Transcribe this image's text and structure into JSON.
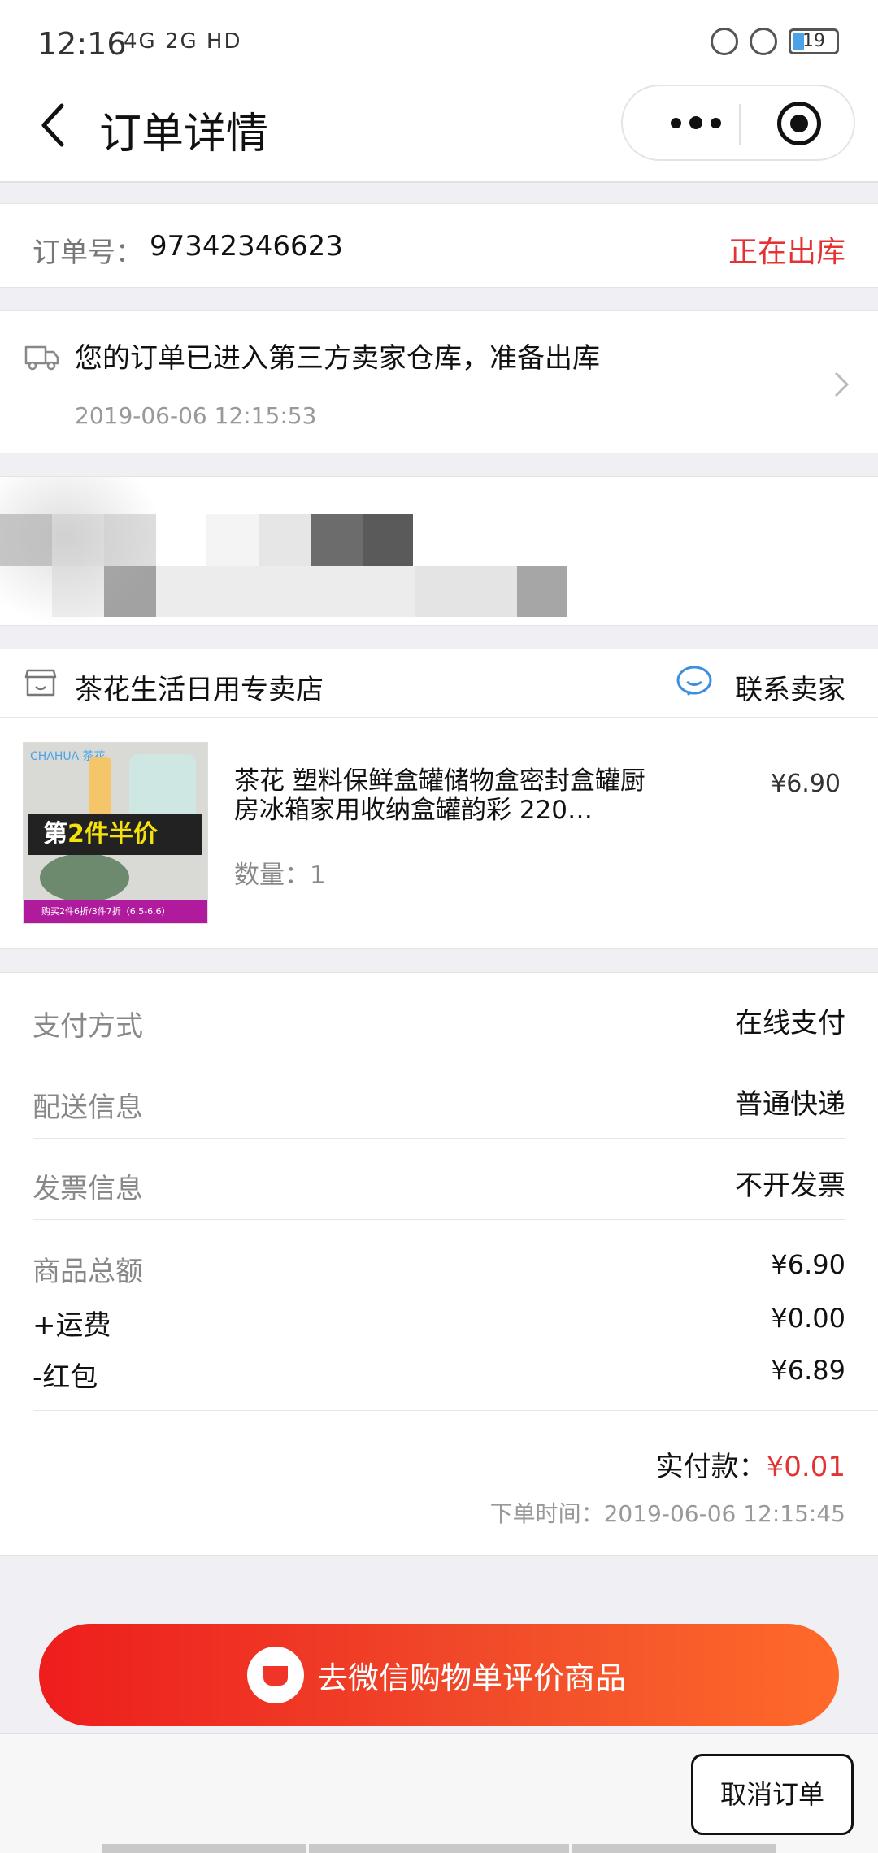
{
  "status_bar": {
    "time": "12:16",
    "signals": "4G 2G HD",
    "battery": "19"
  },
  "nav": {
    "title": "订单详情"
  },
  "order": {
    "number_label": "订单号：",
    "number": "97342346623",
    "status": "正在出库"
  },
  "logistics": {
    "message": "您的订单已进入第三方卖家仓库，准备出库",
    "time": "2019-06-06 12:15:53"
  },
  "shop": {
    "name": "茶花生活日用专卖店",
    "contact_label": "联系卖家"
  },
  "product": {
    "name": "茶花 塑料保鲜盒罐储物盒密封盒罐厨房冰箱家用收纳盒罐韵彩 220…",
    "price": "¥6.90",
    "quantity_label": "数量：1",
    "thumb_brand": "CHAHUA 茶花",
    "thumb_banner_prefix": "第",
    "thumb_banner_number": "2",
    "thumb_banner_suffix": "件半价",
    "thumb_footer": "购买2件6折/3件7折（6.5-6.6）"
  },
  "payment": {
    "rows": [
      {
        "label": "支付方式",
        "value": "在线支付"
      },
      {
        "label": "配送信息",
        "value": "普通快递"
      },
      {
        "label": "发票信息",
        "value": "不开发票"
      }
    ],
    "amounts": [
      {
        "label": "商品总额",
        "value": "¥6.90"
      },
      {
        "label": "+运费",
        "value": "¥0.00"
      },
      {
        "label": "-红包",
        "value": "¥6.89"
      }
    ],
    "paid_label": "实付款：",
    "paid_amount": "¥0.01",
    "order_time": "下单时间：2019-06-06 12:15:45"
  },
  "actions": {
    "review_label": "去微信购物单评价商品",
    "cancel_label": "取消订单"
  },
  "colors": {
    "accent_red": "#e33333",
    "button_gradient_start": "#ee1d1d",
    "button_gradient_end": "#ff6a2a"
  }
}
